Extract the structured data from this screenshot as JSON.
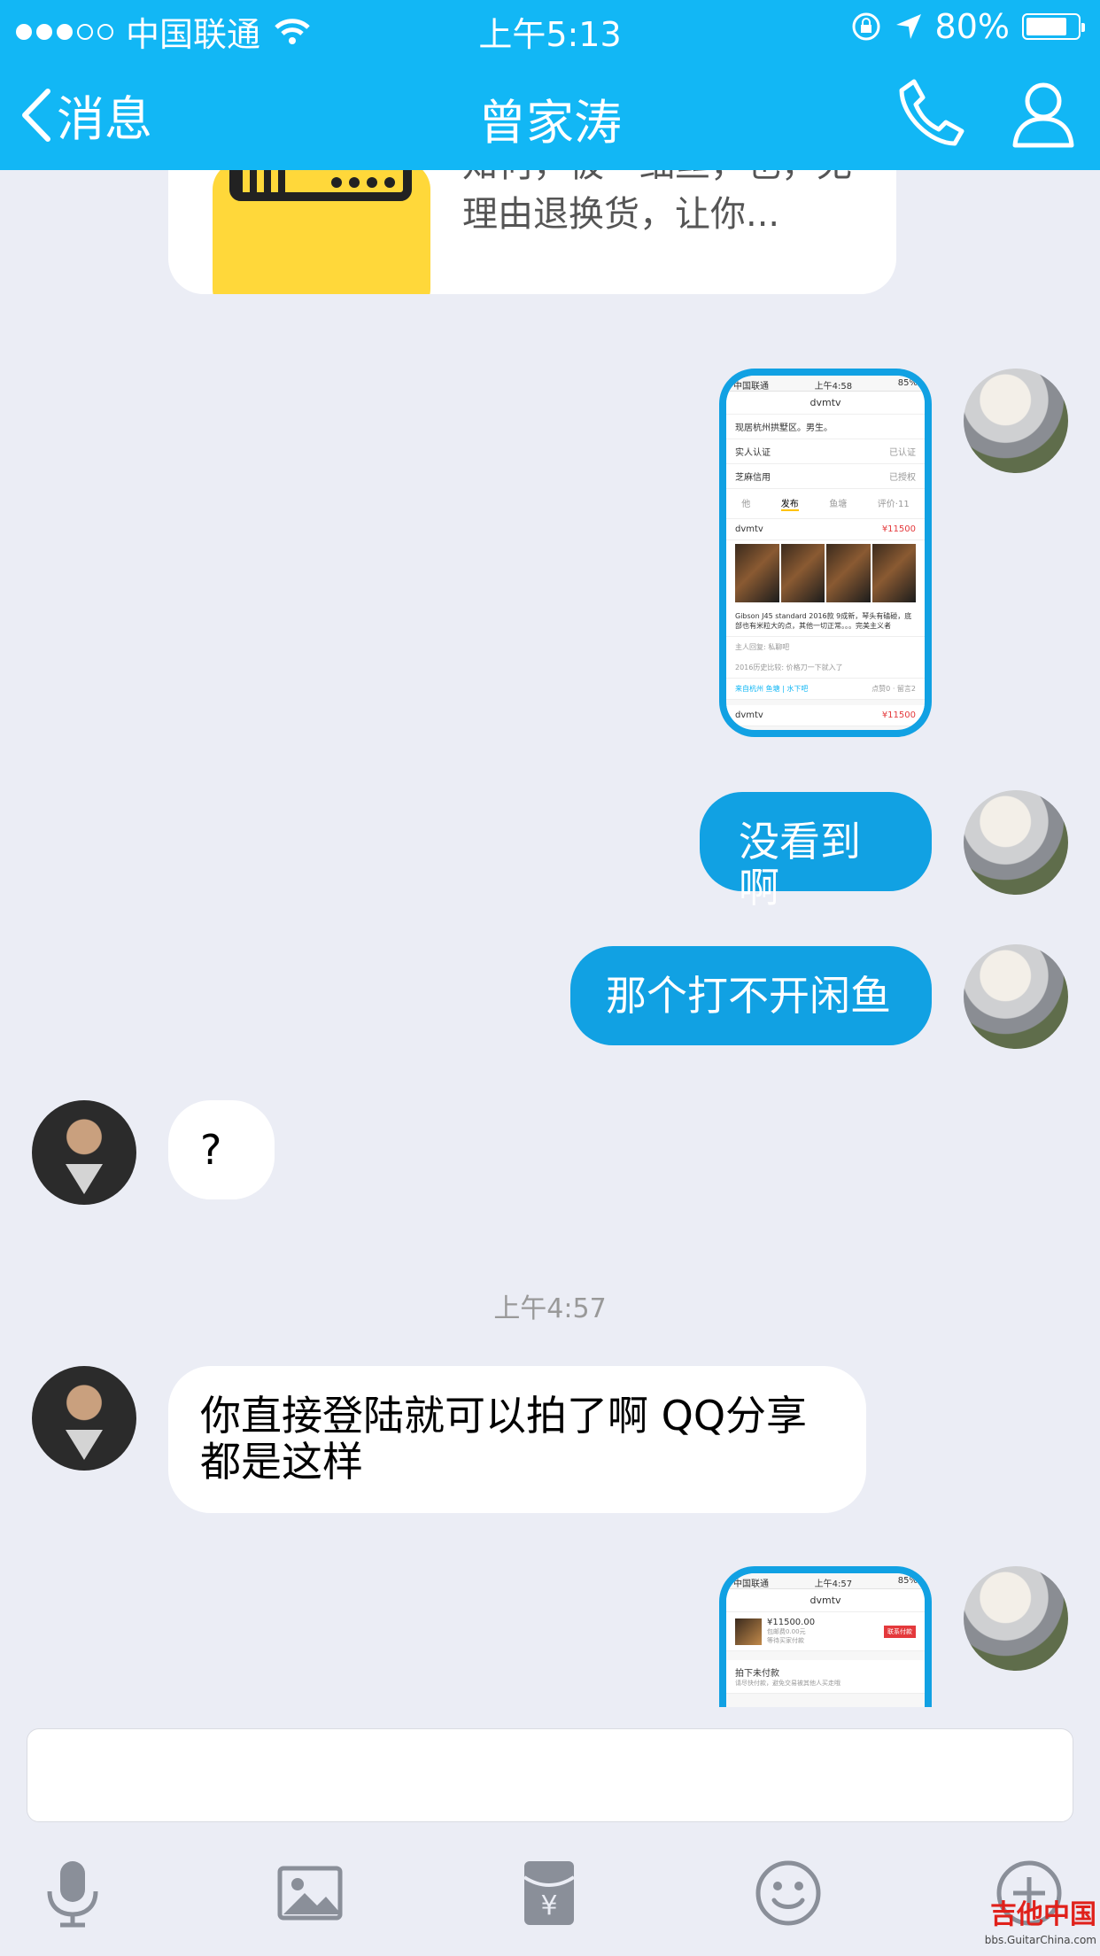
{
  "status_bar": {
    "carrier": "中国联通",
    "time": "上午5:13",
    "battery": "80%",
    "battery_level": 0.8
  },
  "nav": {
    "back_label": "消息",
    "title": "曾家涛"
  },
  "messages": {
    "card_text": "知何，被一细丝，也，无理由退换货，让你...",
    "shot1": {
      "top_title": "dvmtv",
      "profile_line": "现居杭州拱墅区。男生。",
      "verify_label": "实人认证",
      "verify_status": "已认证",
      "credit_label": "芝麻信用",
      "credit_status": "已授权",
      "tabs": [
        "他",
        "发布",
        "鱼塘",
        "评价·11"
      ],
      "seller": "dvmtv",
      "price": "¥11500",
      "desc": "Gibson J45 standard 2016款 9成新，琴头有磕碰，底部也有米粒大的点，其他一切正常。。。完美主义者",
      "note1": "主人回复: 私聊吧",
      "note2": "2016历史比较: 价格刀一下就入了",
      "footer_left": "来自杭州 鱼塘 | 水下吧",
      "footer_right": "点赞0 · 留言2",
      "seller2": "dvmtv",
      "price2": "¥11500"
    },
    "out1": "没看到啊",
    "out2": "那个打不开闲鱼",
    "in1": "?",
    "timestamp": "上午4:57",
    "in2": "你直接登陆就可以拍了啊  QQ分享都是这样",
    "shot2": {
      "top_title": "dvmtv",
      "price": "¥11500.00",
      "line1": "包邮费0.00元",
      "line2": "等待买家付款",
      "pay_button": "联系付款",
      "section": "拍下未付款",
      "section_desc": "请尽快付款，避免交易被其他人买走哦"
    }
  },
  "watermark": {
    "brand": "吉他中国",
    "url": "bbs.GuitarChina.com"
  },
  "colors": {
    "brand": "#12b7f5",
    "outgoing_bubble": "#11a1e3",
    "background": "#ebedf5"
  },
  "icons": [
    "chevron-left-icon",
    "phone-icon",
    "person-icon",
    "mic-icon",
    "image-icon",
    "red-packet-icon",
    "emoji-icon",
    "plus-icon"
  ]
}
